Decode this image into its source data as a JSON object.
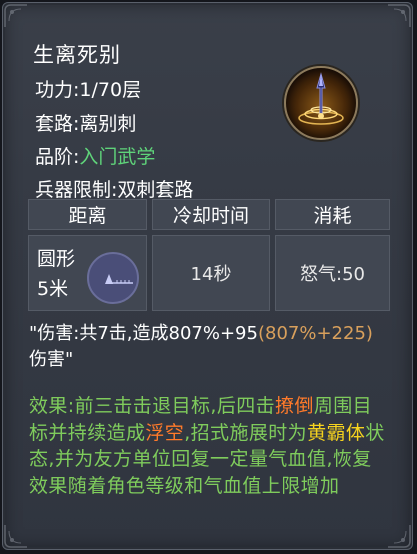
{
  "skill": {
    "name": "生离死别",
    "power_label": "功力:",
    "power_value": "1/70层",
    "style_label": "套路:",
    "style_value": "离别刺",
    "rank_label": "品阶:",
    "rank_value": "入门武学",
    "weapon_label": "兵器限制:",
    "weapon_value": "双刺套路",
    "icon": "spear-vortex-icon"
  },
  "stats": {
    "range_header": "距离",
    "cooldown_header": "冷却时间",
    "cost_header": "消耗",
    "range_shape": "圆形",
    "range_distance": "5米",
    "range_icon": "circle-range-icon",
    "cooldown_value": "14秒",
    "cost_value": "怒气:50"
  },
  "damage": {
    "prefix": "\"伤害:共7击,造成807%+95",
    "scaling": "(807%+225)",
    "suffix": "伤害\""
  },
  "effect": {
    "part1": "效果:前三击击退目标,后四击",
    "highlight1": "撩倒",
    "part2": "周围目标并持续造成",
    "highlight2": "浮空",
    "part3": ",招式施展时为",
    "highlight3": "黄霸体",
    "part4": "状态,并为友方单位回复一定量气血值,恢复效果随着角色等级和气血值上限增加"
  },
  "colors": {
    "panel_bg": "#353a44",
    "text_white": "#ffffff",
    "rank_green": "#5fd47a",
    "effect_green": "#7fcc5c",
    "highlight_orange": "#ff7a2a",
    "highlight_yellow": "#f5d21e",
    "scaling_gold": "#d9a05c"
  }
}
